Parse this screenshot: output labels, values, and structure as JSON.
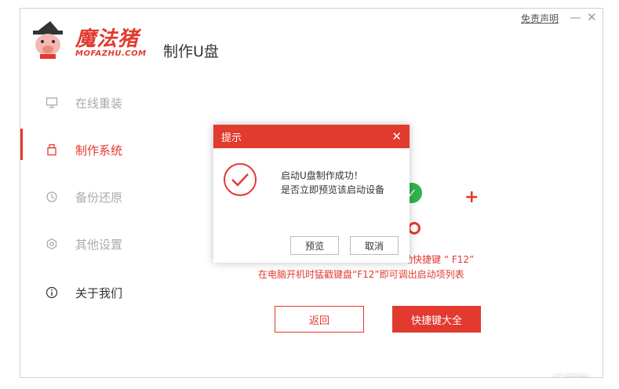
{
  "header": {
    "brand": "魔法猪",
    "brand_sub": "MOFAZHU.COM",
    "page_title": "制作U盘",
    "disclaimer": "免责声明",
    "minimize": "—",
    "close": "✕"
  },
  "sidebar": {
    "items": [
      {
        "label": "在线重装",
        "icon": "monitor-icon"
      },
      {
        "label": "制作系统",
        "icon": "usb-icon"
      },
      {
        "label": "备份还原",
        "icon": "backup-icon"
      },
      {
        "label": "其他设置",
        "icon": "settings-icon"
      },
      {
        "label": "关于我们",
        "icon": "info-icon"
      }
    ],
    "active_index": 1
  },
  "main": {
    "hotkey_line1": "动快捷键 “ F12”",
    "hotkey_line2": "在电脑开机时猛戳键盘“F12”即可调出启动项列表",
    "back_button": "返回",
    "hotkeys_button": "快捷键大全",
    "accent_color": "#e23a2f",
    "success_color": "#2fb44a"
  },
  "dialog": {
    "title": "提示",
    "close": "✕",
    "message1": "启动U盘制作成功！",
    "message2": "是否立即预览该启动设备",
    "ok_button": "预览",
    "cancel_button": "取消",
    "icon": "check-circle-icon"
  },
  "watermark": "千篇网"
}
